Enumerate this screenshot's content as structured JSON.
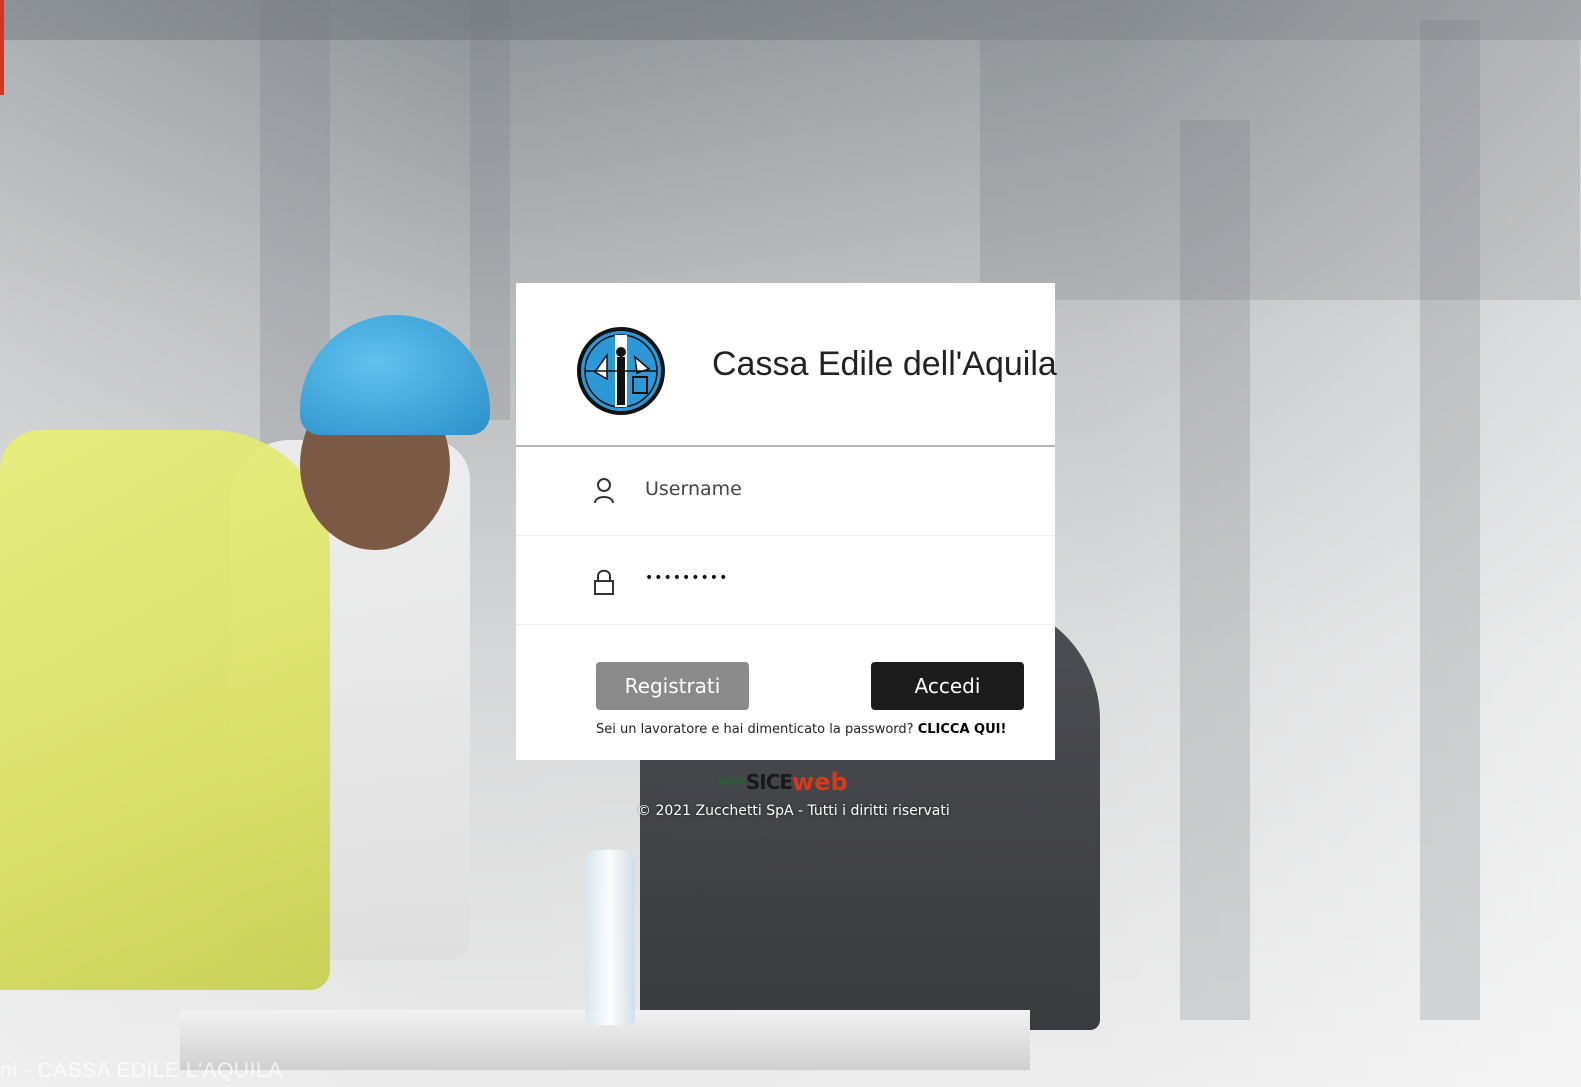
{
  "card": {
    "title": "Cassa Edile dell'Aquila",
    "username": {
      "placeholder": "Username",
      "value": ""
    },
    "password": {
      "value": "•••••••••"
    },
    "register_label": "Registrati",
    "login_label": "Accedi",
    "forgot_text": "Sei un lavoratore e hai dimenticato la password? ",
    "forgot_link": "CLICCA QUI!"
  },
  "footer": {
    "brand_num": "2010",
    "brand_sice": "SICE",
    "brand_web": "web",
    "copyright": "© 2021 Zucchetti SpA - Tutti i diritti riservati"
  },
  "background": {
    "caption": "ni - CASSA EDILE L'AQUILA"
  },
  "icons": {
    "logo": "cassa-edile-logo",
    "username": "user-icon",
    "password": "lock-icon"
  },
  "colors": {
    "login_button": "#1c1c1c",
    "register_button": "#8a8a8a",
    "helmet": "#2b90c9",
    "brand_web": "#d63a1a"
  }
}
